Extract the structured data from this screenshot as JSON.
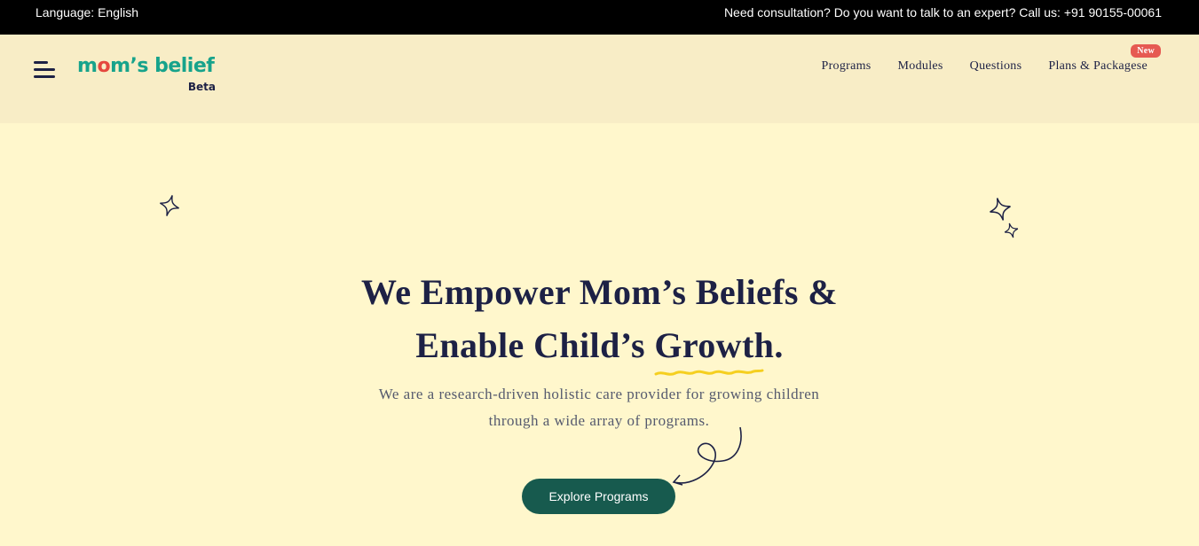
{
  "topbar": {
    "language": "Language: English",
    "consultation": "Need consultation? Do you want to talk to an expert? Call us: +91 90155-00061"
  },
  "header": {
    "logo": {
      "text_prefix": "m",
      "text_o": "o",
      "text_rest": "m’s belief",
      "beta": "Beta"
    },
    "nav": [
      {
        "label": "Programs"
      },
      {
        "label": "Modules"
      },
      {
        "label": "Questions"
      },
      {
        "label": "Plans & Packagese",
        "badge": "New"
      }
    ]
  },
  "hero": {
    "title_line1": "We Empower Mom’s Beliefs &",
    "title_line2_before": "Enable Child’s ",
    "title_line2_highlight": "Growth",
    "title_line2_after": ".",
    "subtitle": "We are a research-driven holistic care provider for growing children through a wide array of programs.",
    "cta": "Explore Programs"
  },
  "colors": {
    "background": "#fff7cc",
    "header_bg": "#f8edc6",
    "topbar_bg": "#000000",
    "brand_teal": "#17a38b",
    "cta_bg": "#175a4e",
    "badge_red": "#e65a52",
    "squiggle_yellow": "#f5cf1f",
    "text_navy": "#1d2145"
  },
  "icons": [
    "hamburger-menu-icon",
    "sparkle-star-icon",
    "curly-arrow-icon"
  ]
}
